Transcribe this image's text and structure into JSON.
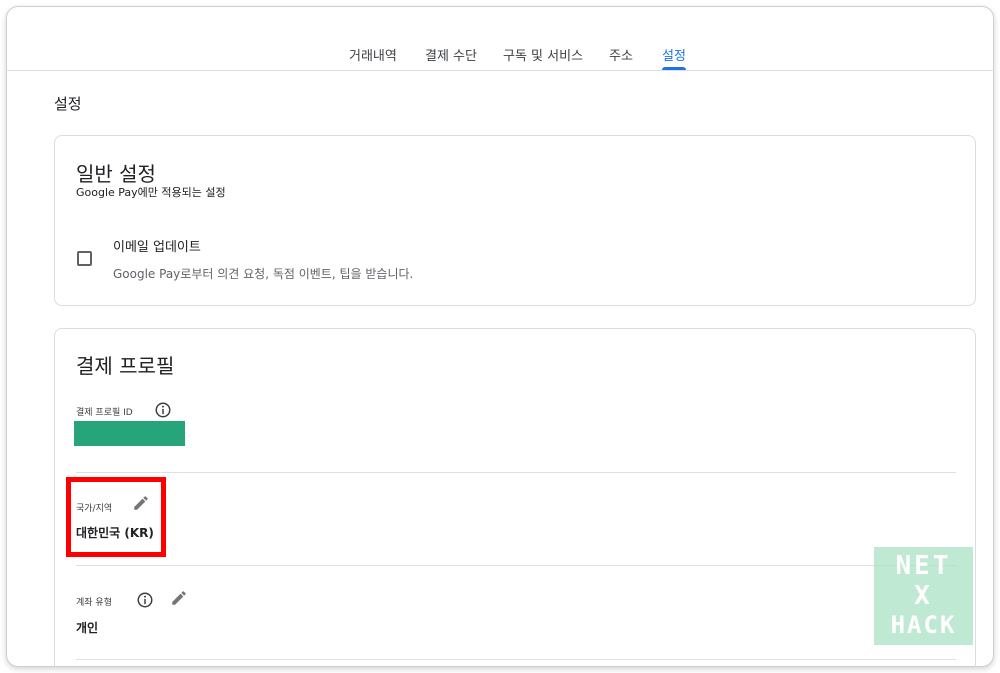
{
  "tabs": [
    {
      "label": "거래내역",
      "active": false
    },
    {
      "label": "결제 수단",
      "active": false
    },
    {
      "label": "구독 및 서비스",
      "active": false
    },
    {
      "label": "주소",
      "active": false
    },
    {
      "label": "설정",
      "active": true
    }
  ],
  "page_title": "설정",
  "general_settings": {
    "title": "일반 설정",
    "subtitle": "Google Pay에만 적용되는 설정",
    "email_updates": {
      "label": "이메일 업데이트",
      "description": "Google Pay로부터 의견 요청, 독점 이벤트, 팁을 받습니다.",
      "checked": false
    }
  },
  "payment_profile": {
    "title": "결제 프로필",
    "profile_id": {
      "label": "결제 프로필 ID",
      "value_redacted": true
    },
    "country": {
      "label": "국가/지역",
      "value": "대한민국 (KR)"
    },
    "account_type": {
      "label": "계좌 유형",
      "value": "개인"
    }
  },
  "watermark": {
    "line1": "NET",
    "line2": "X",
    "line3": "HACK"
  },
  "colors": {
    "accent": "#1a73e8",
    "highlight": "#ff0000",
    "redaction": "#27a47a"
  }
}
